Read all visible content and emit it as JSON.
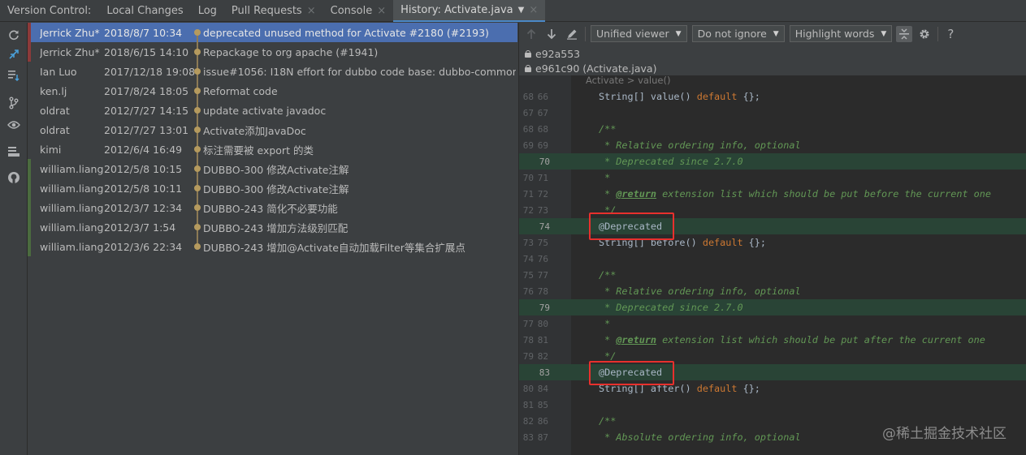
{
  "tabbar": {
    "label": "Version Control:",
    "tabs": [
      {
        "label": "Local Changes",
        "closable": false,
        "active": false
      },
      {
        "label": "Log",
        "closable": false,
        "active": false
      },
      {
        "label": "Pull Requests",
        "closable": true,
        "active": false
      },
      {
        "label": "Console",
        "closable": true,
        "active": false
      },
      {
        "label": "History: Activate.java",
        "closable": true,
        "active": true
      }
    ],
    "close_glyph": "×",
    "dropdown_glyph": "▼"
  },
  "toolstrip": {
    "icons": [
      "refresh-icon",
      "diff-icon",
      "merge-icon",
      "branch-icon",
      "eye-icon",
      "layout-icon",
      "github-icon"
    ]
  },
  "commits": [
    {
      "author": "Jerrick Zhu*",
      "date": "2018/8/7 10:34",
      "message": "deprecated unused method for Activate #2180 (#2193)",
      "selected": true,
      "stripe": "#8c3a3a"
    },
    {
      "author": "Jerrick Zhu*",
      "date": "2018/6/15 14:10",
      "message": "Repackage to org apache (#1941)",
      "selected": false,
      "stripe": "#8c3a3a"
    },
    {
      "author": "Ian Luo",
      "date": "2017/12/18 19:08",
      "message": "issue#1056: I18N effort for dubbo code base: dubbo-common",
      "selected": false,
      "stripe": ""
    },
    {
      "author": "ken.lj",
      "date": "2017/8/24 18:05",
      "message": "Reformat code",
      "selected": false,
      "stripe": ""
    },
    {
      "author": "oldrat",
      "date": "2012/7/27 14:15",
      "message": "update activate javadoc",
      "selected": false,
      "stripe": ""
    },
    {
      "author": "oldrat",
      "date": "2012/7/27 13:01",
      "message": "Activate添加JavaDoc",
      "selected": false,
      "stripe": ""
    },
    {
      "author": "kimi",
      "date": "2012/6/4 16:49",
      "message": "标注需要被 export 的类",
      "selected": false,
      "stripe": ""
    },
    {
      "author": "william.liangf",
      "date": "2012/5/8 10:15",
      "message": "DUBBO-300 修改Activate注解",
      "selected": false,
      "stripe": "#4b6b3f"
    },
    {
      "author": "william.liangf",
      "date": "2012/5/8 10:11",
      "message": "DUBBO-300 修改Activate注解",
      "selected": false,
      "stripe": "#4b6b3f"
    },
    {
      "author": "william.liangf",
      "date": "2012/3/7 12:34",
      "message": "DUBBO-243 简化不必要功能",
      "selected": false,
      "stripe": "#4b6b3f"
    },
    {
      "author": "william.liangf",
      "date": "2012/3/7 1:54",
      "message": "DUBBO-243 增加方法级别匹配",
      "selected": false,
      "stripe": "#4b6b3f"
    },
    {
      "author": "william.liangf",
      "date": "2012/3/6 22:34",
      "message": "DUBBO-243 增加@Activate自动加载Filter等集合扩展点",
      "selected": false,
      "stripe": "#4b6b3f"
    }
  ],
  "difftoolbar": {
    "viewer": "Unified viewer",
    "ignore": "Do not ignore",
    "highlight": "Highlight words",
    "help": "?"
  },
  "revisions": [
    "e92a553",
    "e961c90 (Activate.java)"
  ],
  "breadcrumb": "Activate > value()",
  "code_lines": [
    {
      "old": "68",
      "new": "66",
      "added": false,
      "html": "String[] value() <span class=\"kw\">default</span> {};"
    },
    {
      "old": "67",
      "new": "67",
      "added": false,
      "html": ""
    },
    {
      "old": "68",
      "new": "68",
      "added": false,
      "html": "<span class=\"cm\">/**</span>"
    },
    {
      "old": "69",
      "new": "69",
      "added": false,
      "html": "<span class=\"cm\"> * Relative ordering info, optional</span>"
    },
    {
      "old": "",
      "new": "70",
      "added": true,
      "html": "<span class=\"cm\"> * Deprecated since 2.7.0</span>"
    },
    {
      "old": "70",
      "new": "71",
      "added": false,
      "html": "<span class=\"cm\"> *</span>"
    },
    {
      "old": "71",
      "new": "72",
      "added": false,
      "html": "<span class=\"cm\"> * </span><span class=\"tag\">@return</span><span class=\"cm\"> extension list which should be put before the current one</span>"
    },
    {
      "old": "72",
      "new": "73",
      "added": false,
      "html": "<span class=\"cm\"> */</span>"
    },
    {
      "old": "",
      "new": "74",
      "added": true,
      "html": "<span class=\"anno-code\">@Deprecated</span>"
    },
    {
      "old": "73",
      "new": "75",
      "added": false,
      "html": "String[] before() <span class=\"kw\">default</span> {};"
    },
    {
      "old": "74",
      "new": "76",
      "added": false,
      "html": ""
    },
    {
      "old": "75",
      "new": "77",
      "added": false,
      "html": "<span class=\"cm\">/**</span>"
    },
    {
      "old": "76",
      "new": "78",
      "added": false,
      "html": "<span class=\"cm\"> * Relative ordering info, optional</span>"
    },
    {
      "old": "",
      "new": "79",
      "added": true,
      "html": "<span class=\"cm\"> * Deprecated since 2.7.0</span>"
    },
    {
      "old": "77",
      "new": "80",
      "added": false,
      "html": "<span class=\"cm\"> *</span>"
    },
    {
      "old": "78",
      "new": "81",
      "added": false,
      "html": "<span class=\"cm\"> * </span><span class=\"tag\">@return</span><span class=\"cm\"> extension list which should be put after the current one</span>"
    },
    {
      "old": "79",
      "new": "82",
      "added": false,
      "html": "<span class=\"cm\"> */</span>"
    },
    {
      "old": "",
      "new": "83",
      "added": true,
      "html": "<span class=\"anno-code\">@Deprecated</span>"
    },
    {
      "old": "80",
      "new": "84",
      "added": false,
      "html": "String[] after() <span class=\"kw\">default</span> {};"
    },
    {
      "old": "81",
      "new": "85",
      "added": false,
      "html": ""
    },
    {
      "old": "82",
      "new": "86",
      "added": false,
      "html": "<span class=\"cm\">/**</span>"
    },
    {
      "old": "83",
      "new": "87",
      "added": false,
      "html": "<span class=\"cm\"> * Absolute ordering info, optional</span>"
    }
  ],
  "watermark": "@稀土掘金技术社区",
  "colors": {
    "selection": "#4b6eaf",
    "added_line": "#294436",
    "highlight_box": "#e8302d"
  }
}
